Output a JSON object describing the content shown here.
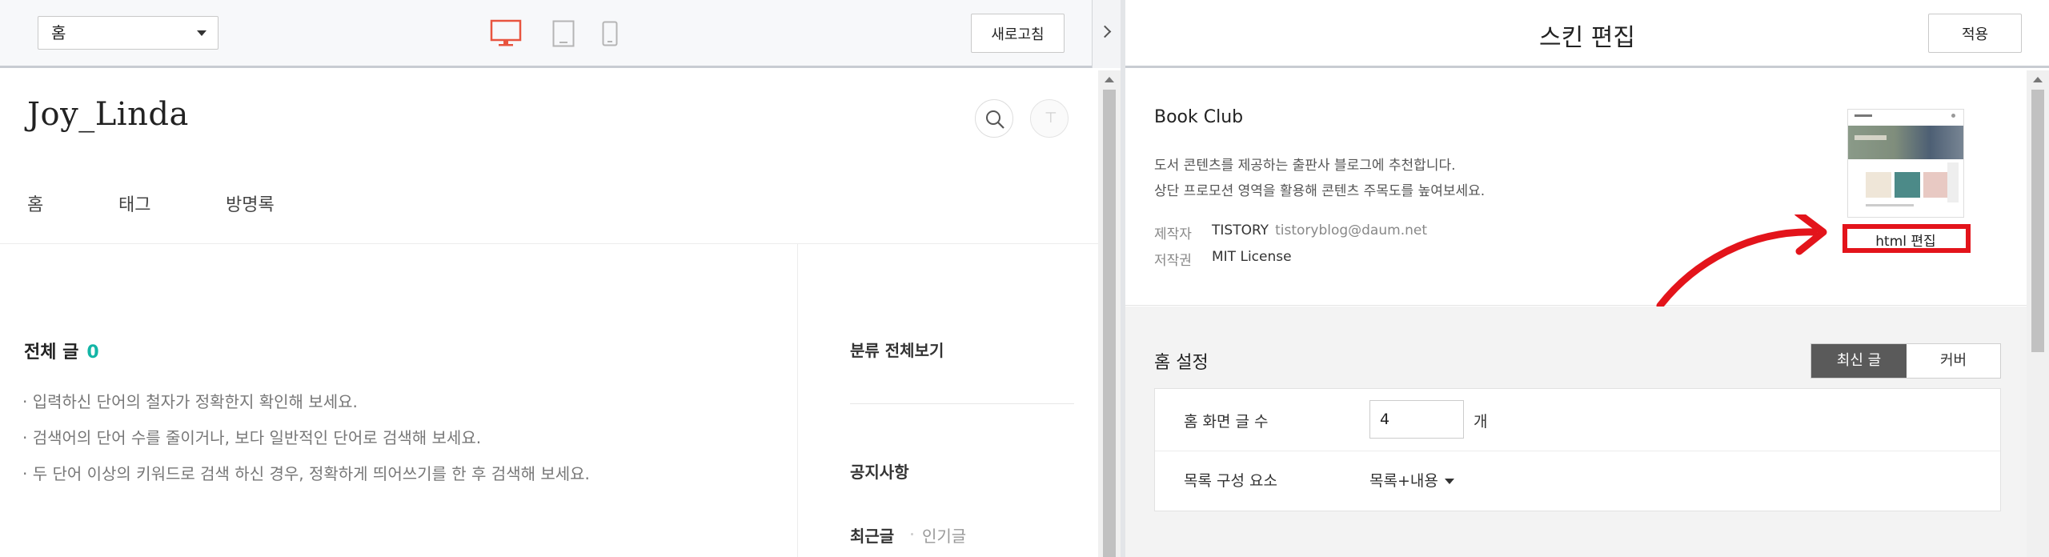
{
  "preview": {
    "page_select": "홈",
    "refresh_label": "새로고침",
    "blog_title": "Joy_Linda",
    "nav": [
      "홈",
      "태그",
      "방명록"
    ],
    "total_label": "전체 글",
    "total_count": "0",
    "tips": [
      "· 입력하신 단어의 철자가 정확한지 확인해 보세요.",
      "· 검색어의 단어 수를 줄이거나, 보다 일반적인 단어로 검색해 보세요.",
      "· 두 단어 이상의 키워드로 검색 하신 경우, 정확하게 띄어쓰기를 한 후 검색해 보세요."
    ],
    "sidebar": {
      "category": "분류 전체보기",
      "notice": "공지사항",
      "recent": "최근글",
      "popular": "인기글"
    },
    "icons": [
      "desktop-icon",
      "tablet-icon",
      "mobile-icon",
      "chevron-right-icon",
      "search-icon"
    ]
  },
  "editor": {
    "title": "스킨 편집",
    "apply_label": "적용",
    "skin": {
      "name": "Book Club",
      "description": [
        "도서 콘텐츠를 제공하는 출판사 블로그에 추천합니다.",
        "상단 프로모션 영역을 활용해 콘텐츠 주목도를 높여보세요."
      ],
      "maker_label": "제작자",
      "maker": "TISTORY",
      "maker_email": "tistoryblog@daum.net",
      "license_label": "저작권",
      "license": "MIT License",
      "html_edit_label": "html 편집"
    },
    "home_settings": {
      "title": "홈 설정",
      "tabs": [
        "최신 글",
        "커버"
      ],
      "post_count_label": "홈 화면 글 수",
      "post_count_value": "4",
      "post_count_unit": "개",
      "list_label": "목록 구성 요소",
      "list_value": "목록+내용"
    }
  },
  "colors": {
    "accent_count": "#13b5a6",
    "active_device": "#e8543f",
    "annotation_red": "#e3141b",
    "segment_active": "#5a5a5a"
  }
}
